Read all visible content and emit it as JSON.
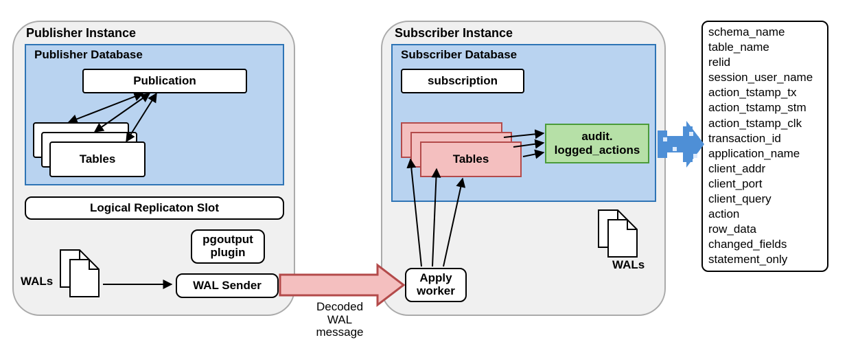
{
  "publisher": {
    "title": "Publisher Instance",
    "db_title": "Publisher Database",
    "publication": "Publication",
    "tables": "Tables",
    "replication_slot": "Logical Replicaton Slot",
    "plugin": "pgoutput plugin",
    "wal_sender": "WAL Sender",
    "wals_label": "WALs"
  },
  "subscriber": {
    "title": "Subscriber Instance",
    "db_title": "Subscriber Database",
    "subscription": "subscription",
    "tables": "Tables",
    "audit": "audit.\nlogged_actions",
    "apply_worker": "Apply worker",
    "wals_label": "WALs"
  },
  "transport_label": "Decoded WAL message",
  "fields": [
    "schema_name",
    "table_name",
    "relid",
    "session_user_name",
    "action_tstamp_tx",
    "action_tstamp_stm",
    "action_tstamp_clk",
    "transaction_id",
    "application_name",
    "client_addr",
    "client_port",
    "client_query",
    "action",
    "row_data",
    "changed_fields",
    "statement_only"
  ]
}
